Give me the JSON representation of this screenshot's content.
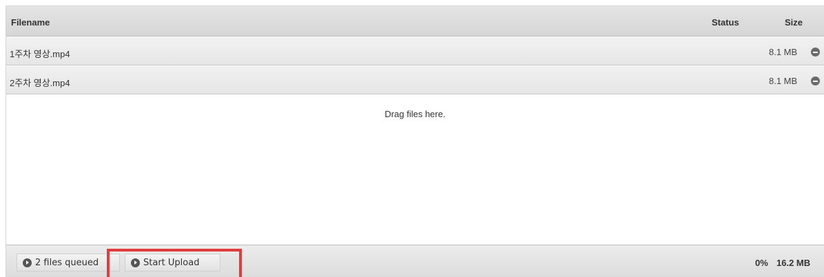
{
  "header": {
    "filename": "Filename",
    "status": "Status",
    "size": "Size"
  },
  "files": [
    {
      "name": "1주차 영상.mp4",
      "size": "8.1 MB"
    },
    {
      "name": "2주차 영상.mp4",
      "size": "8.1 MB"
    }
  ],
  "dropzone": {
    "message": "Drag files here."
  },
  "footer": {
    "queued_label": "2 files queued",
    "start_label": "Start Upload",
    "percent": "0%",
    "total_size": "16.2 MB"
  },
  "icons": {
    "remove": "minus-circle-icon",
    "button": "arrow-circle-icon"
  },
  "colors": {
    "highlight": "#e23b3b"
  }
}
